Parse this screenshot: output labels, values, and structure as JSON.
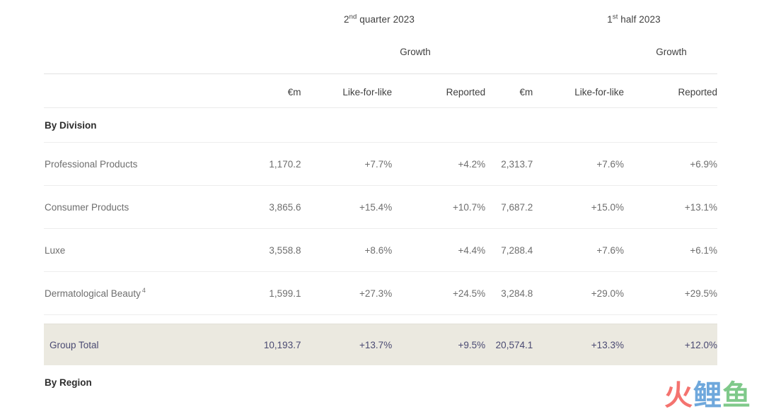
{
  "periods": [
    {
      "ordinal_num": "2",
      "ordinal_suffix": "nd",
      "rest": " quarter 2023"
    },
    {
      "ordinal_num": "1",
      "ordinal_suffix": "st",
      "rest": " half 2023"
    }
  ],
  "growth_label_q2": "Growth",
  "growth_label_h1": "Growth",
  "columns": {
    "label": "",
    "q2_em": "€m",
    "q2_lfl": "Like-for-like",
    "q2_rep": "Reported",
    "h1_em": "€m",
    "h1_lfl": "Like-for-like",
    "h1_rep": "Reported"
  },
  "sections": {
    "by_division": "By Division",
    "by_region": "By Region"
  },
  "rows": [
    {
      "label": "Professional Products",
      "footnote": "",
      "q2_em": "1,170.2",
      "q2_lfl": "+7.7%",
      "q2_rep": "+4.2%",
      "h1_em": "2,313.7",
      "h1_lfl": "+7.6%",
      "h1_rep": "+6.9%"
    },
    {
      "label": "Consumer Products",
      "footnote": "",
      "q2_em": "3,865.6",
      "q2_lfl": "+15.4%",
      "q2_rep": "+10.7%",
      "h1_em": "7,687.2",
      "h1_lfl": "+15.0%",
      "h1_rep": "+13.1%"
    },
    {
      "label": "Luxe",
      "footnote": "",
      "q2_em": "3,558.8",
      "q2_lfl": "+8.6%",
      "q2_rep": "+4.4%",
      "h1_em": "7,288.4",
      "h1_lfl": "+7.6%",
      "h1_rep": "+6.1%"
    },
    {
      "label": "Dermatological Beauty",
      "footnote": "4",
      "q2_em": "1,599.1",
      "q2_lfl": "+27.3%",
      "q2_rep": "+24.5%",
      "h1_em": "3,284.8",
      "h1_lfl": "+29.0%",
      "h1_rep": "+29.5%"
    }
  ],
  "total_row": {
    "label": "Group Total",
    "q2_em": "10,193.7",
    "q2_lfl": "+13.7%",
    "q2_rep": "+9.5%",
    "h1_em": "20,574.1",
    "h1_lfl": "+13.3%",
    "h1_rep": "+12.0%"
  },
  "watermark": {
    "char1": "火",
    "char2": "鲤",
    "char3": "鱼"
  },
  "colors": {
    "total_row_background": "#ebe9e0",
    "total_row_text": "#4a4a72",
    "body_text": "#6e6e6e",
    "heading_text": "#2d2d2d",
    "rule": "#ededed",
    "watermark_red": "#f4736f",
    "watermark_blue": "#6fa8dc",
    "watermark_green": "#7fc98a"
  }
}
